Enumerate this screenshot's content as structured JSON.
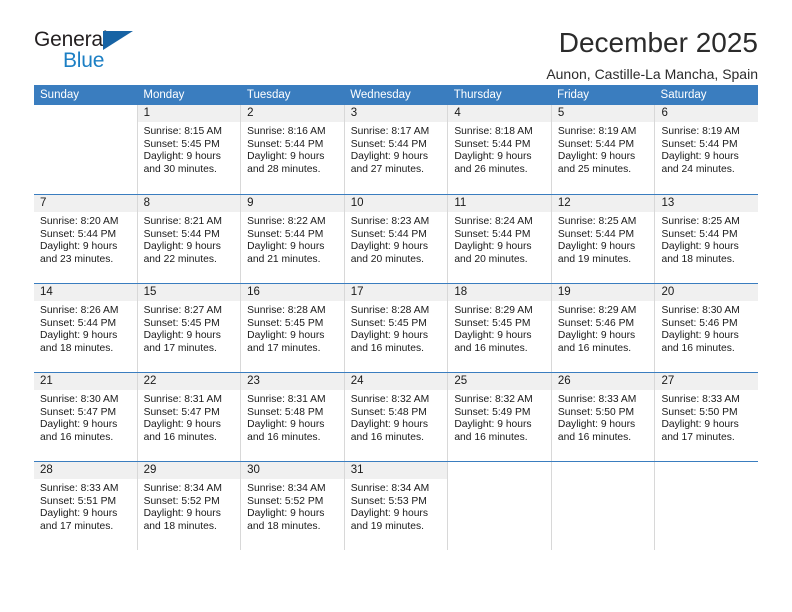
{
  "brand": {
    "name_top": "General",
    "name_bottom": "Blue",
    "accent_color": "#1c7fc4",
    "triangle_color": "#1763a4",
    "logo_icon": "triangle-flag-icon"
  },
  "header": {
    "month_title": "December 2025",
    "location": "Aunon, Castille-La Mancha, Spain"
  },
  "calendar": {
    "header_bg": "#3a7dbf",
    "daynum_bg": "#f0f0f0",
    "weekdays": [
      "Sunday",
      "Monday",
      "Tuesday",
      "Wednesday",
      "Thursday",
      "Friday",
      "Saturday"
    ],
    "weeks": [
      [
        {
          "day": "",
          "sunrise": "",
          "sunset": "",
          "daylight_line1": "",
          "daylight_line2": ""
        },
        {
          "day": "1",
          "sunrise": "Sunrise: 8:15 AM",
          "sunset": "Sunset: 5:45 PM",
          "daylight_line1": "Daylight: 9 hours",
          "daylight_line2": "and 30 minutes."
        },
        {
          "day": "2",
          "sunrise": "Sunrise: 8:16 AM",
          "sunset": "Sunset: 5:44 PM",
          "daylight_line1": "Daylight: 9 hours",
          "daylight_line2": "and 28 minutes."
        },
        {
          "day": "3",
          "sunrise": "Sunrise: 8:17 AM",
          "sunset": "Sunset: 5:44 PM",
          "daylight_line1": "Daylight: 9 hours",
          "daylight_line2": "and 27 minutes."
        },
        {
          "day": "4",
          "sunrise": "Sunrise: 8:18 AM",
          "sunset": "Sunset: 5:44 PM",
          "daylight_line1": "Daylight: 9 hours",
          "daylight_line2": "and 26 minutes."
        },
        {
          "day": "5",
          "sunrise": "Sunrise: 8:19 AM",
          "sunset": "Sunset: 5:44 PM",
          "daylight_line1": "Daylight: 9 hours",
          "daylight_line2": "and 25 minutes."
        },
        {
          "day": "6",
          "sunrise": "Sunrise: 8:19 AM",
          "sunset": "Sunset: 5:44 PM",
          "daylight_line1": "Daylight: 9 hours",
          "daylight_line2": "and 24 minutes."
        }
      ],
      [
        {
          "day": "7",
          "sunrise": "Sunrise: 8:20 AM",
          "sunset": "Sunset: 5:44 PM",
          "daylight_line1": "Daylight: 9 hours",
          "daylight_line2": "and 23 minutes."
        },
        {
          "day": "8",
          "sunrise": "Sunrise: 8:21 AM",
          "sunset": "Sunset: 5:44 PM",
          "daylight_line1": "Daylight: 9 hours",
          "daylight_line2": "and 22 minutes."
        },
        {
          "day": "9",
          "sunrise": "Sunrise: 8:22 AM",
          "sunset": "Sunset: 5:44 PM",
          "daylight_line1": "Daylight: 9 hours",
          "daylight_line2": "and 21 minutes."
        },
        {
          "day": "10",
          "sunrise": "Sunrise: 8:23 AM",
          "sunset": "Sunset: 5:44 PM",
          "daylight_line1": "Daylight: 9 hours",
          "daylight_line2": "and 20 minutes."
        },
        {
          "day": "11",
          "sunrise": "Sunrise: 8:24 AM",
          "sunset": "Sunset: 5:44 PM",
          "daylight_line1": "Daylight: 9 hours",
          "daylight_line2": "and 20 minutes."
        },
        {
          "day": "12",
          "sunrise": "Sunrise: 8:25 AM",
          "sunset": "Sunset: 5:44 PM",
          "daylight_line1": "Daylight: 9 hours",
          "daylight_line2": "and 19 minutes."
        },
        {
          "day": "13",
          "sunrise": "Sunrise: 8:25 AM",
          "sunset": "Sunset: 5:44 PM",
          "daylight_line1": "Daylight: 9 hours",
          "daylight_line2": "and 18 minutes."
        }
      ],
      [
        {
          "day": "14",
          "sunrise": "Sunrise: 8:26 AM",
          "sunset": "Sunset: 5:44 PM",
          "daylight_line1": "Daylight: 9 hours",
          "daylight_line2": "and 18 minutes."
        },
        {
          "day": "15",
          "sunrise": "Sunrise: 8:27 AM",
          "sunset": "Sunset: 5:45 PM",
          "daylight_line1": "Daylight: 9 hours",
          "daylight_line2": "and 17 minutes."
        },
        {
          "day": "16",
          "sunrise": "Sunrise: 8:28 AM",
          "sunset": "Sunset: 5:45 PM",
          "daylight_line1": "Daylight: 9 hours",
          "daylight_line2": "and 17 minutes."
        },
        {
          "day": "17",
          "sunrise": "Sunrise: 8:28 AM",
          "sunset": "Sunset: 5:45 PM",
          "daylight_line1": "Daylight: 9 hours",
          "daylight_line2": "and 16 minutes."
        },
        {
          "day": "18",
          "sunrise": "Sunrise: 8:29 AM",
          "sunset": "Sunset: 5:45 PM",
          "daylight_line1": "Daylight: 9 hours",
          "daylight_line2": "and 16 minutes."
        },
        {
          "day": "19",
          "sunrise": "Sunrise: 8:29 AM",
          "sunset": "Sunset: 5:46 PM",
          "daylight_line1": "Daylight: 9 hours",
          "daylight_line2": "and 16 minutes."
        },
        {
          "day": "20",
          "sunrise": "Sunrise: 8:30 AM",
          "sunset": "Sunset: 5:46 PM",
          "daylight_line1": "Daylight: 9 hours",
          "daylight_line2": "and 16 minutes."
        }
      ],
      [
        {
          "day": "21",
          "sunrise": "Sunrise: 8:30 AM",
          "sunset": "Sunset: 5:47 PM",
          "daylight_line1": "Daylight: 9 hours",
          "daylight_line2": "and 16 minutes."
        },
        {
          "day": "22",
          "sunrise": "Sunrise: 8:31 AM",
          "sunset": "Sunset: 5:47 PM",
          "daylight_line1": "Daylight: 9 hours",
          "daylight_line2": "and 16 minutes."
        },
        {
          "day": "23",
          "sunrise": "Sunrise: 8:31 AM",
          "sunset": "Sunset: 5:48 PM",
          "daylight_line1": "Daylight: 9 hours",
          "daylight_line2": "and 16 minutes."
        },
        {
          "day": "24",
          "sunrise": "Sunrise: 8:32 AM",
          "sunset": "Sunset: 5:48 PM",
          "daylight_line1": "Daylight: 9 hours",
          "daylight_line2": "and 16 minutes."
        },
        {
          "day": "25",
          "sunrise": "Sunrise: 8:32 AM",
          "sunset": "Sunset: 5:49 PM",
          "daylight_line1": "Daylight: 9 hours",
          "daylight_line2": "and 16 minutes."
        },
        {
          "day": "26",
          "sunrise": "Sunrise: 8:33 AM",
          "sunset": "Sunset: 5:50 PM",
          "daylight_line1": "Daylight: 9 hours",
          "daylight_line2": "and 16 minutes."
        },
        {
          "day": "27",
          "sunrise": "Sunrise: 8:33 AM",
          "sunset": "Sunset: 5:50 PM",
          "daylight_line1": "Daylight: 9 hours",
          "daylight_line2": "and 17 minutes."
        }
      ],
      [
        {
          "day": "28",
          "sunrise": "Sunrise: 8:33 AM",
          "sunset": "Sunset: 5:51 PM",
          "daylight_line1": "Daylight: 9 hours",
          "daylight_line2": "and 17 minutes."
        },
        {
          "day": "29",
          "sunrise": "Sunrise: 8:34 AM",
          "sunset": "Sunset: 5:52 PM",
          "daylight_line1": "Daylight: 9 hours",
          "daylight_line2": "and 18 minutes."
        },
        {
          "day": "30",
          "sunrise": "Sunrise: 8:34 AM",
          "sunset": "Sunset: 5:52 PM",
          "daylight_line1": "Daylight: 9 hours",
          "daylight_line2": "and 18 minutes."
        },
        {
          "day": "31",
          "sunrise": "Sunrise: 8:34 AM",
          "sunset": "Sunset: 5:53 PM",
          "daylight_line1": "Daylight: 9 hours",
          "daylight_line2": "and 19 minutes."
        },
        {
          "day": "",
          "sunrise": "",
          "sunset": "",
          "daylight_line1": "",
          "daylight_line2": ""
        },
        {
          "day": "",
          "sunrise": "",
          "sunset": "",
          "daylight_line1": "",
          "daylight_line2": ""
        },
        {
          "day": "",
          "sunrise": "",
          "sunset": "",
          "daylight_line1": "",
          "daylight_line2": ""
        }
      ]
    ]
  }
}
